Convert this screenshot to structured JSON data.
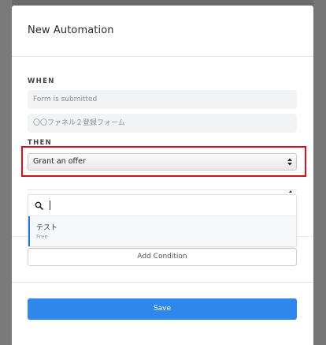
{
  "modal": {
    "title": "New Automation"
  },
  "when": {
    "label": "WHEN",
    "trigger": "Form is submitted",
    "form": "〇〇ファネル２登録フォーム"
  },
  "then": {
    "label": "THEN",
    "action_selected": "Grant an offer"
  },
  "offer_dropdown": {
    "search_value": "",
    "options": [
      {
        "name": "テスト",
        "sub": "Free"
      }
    ]
  },
  "buttons": {
    "add_condition": "Add Condition",
    "save": "Save"
  },
  "colors": {
    "primary": "#2f86eb",
    "highlight": "#d3131c",
    "selected_accent": "#2b79d6"
  },
  "icons": {
    "search": "search-icon",
    "select_arrows": "select-arrows-icon",
    "caret": "caret-up-icon"
  }
}
